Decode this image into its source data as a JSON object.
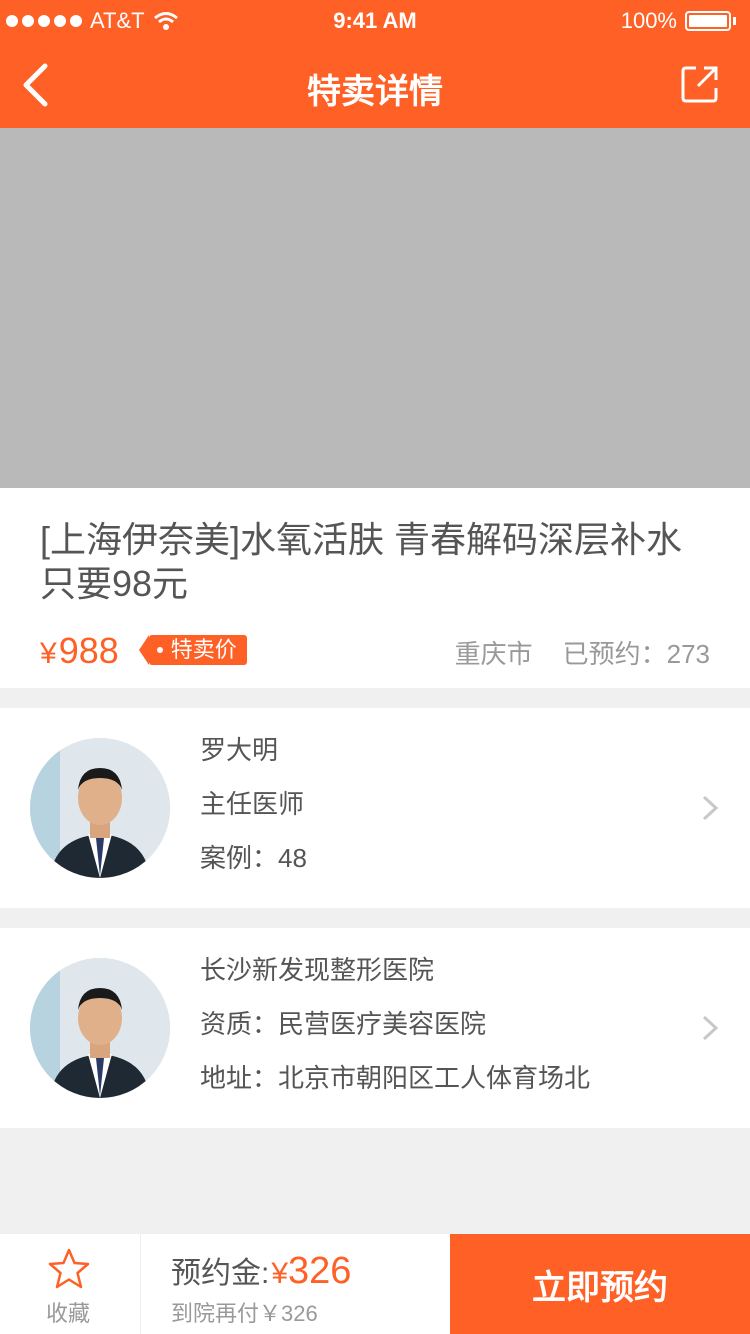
{
  "status_bar": {
    "carrier": "AT&T",
    "time": "9:41 AM",
    "battery": "100%"
  },
  "nav": {
    "title": "特卖详情",
    "back_icon": "chevron-left-icon",
    "share_icon": "share-icon"
  },
  "product": {
    "title": "[上海伊奈美]水氧活肤 青春解码深层补水只要98元",
    "price_symbol": "¥",
    "price": "988",
    "tag": "特卖价",
    "city": "重庆市",
    "booked": "已预约：273"
  },
  "doctor": {
    "name": "罗大明",
    "title": "主任医师",
    "cases": "案例：48"
  },
  "hospital": {
    "name": "长沙新发现整形医院",
    "qualification": "资质：民营医疗美容医院",
    "address": "地址：北京市朝阳区工人体育场北"
  },
  "bottom_bar": {
    "favorite": "收藏",
    "deposit_label": "预约金:",
    "deposit_symbol": "¥",
    "deposit_value": "326",
    "pay_on_arrival": "到院再付￥326",
    "book_button": "立即预约"
  },
  "colors": {
    "accent": "#FE6025",
    "text": "#555555",
    "muted": "#999999"
  }
}
